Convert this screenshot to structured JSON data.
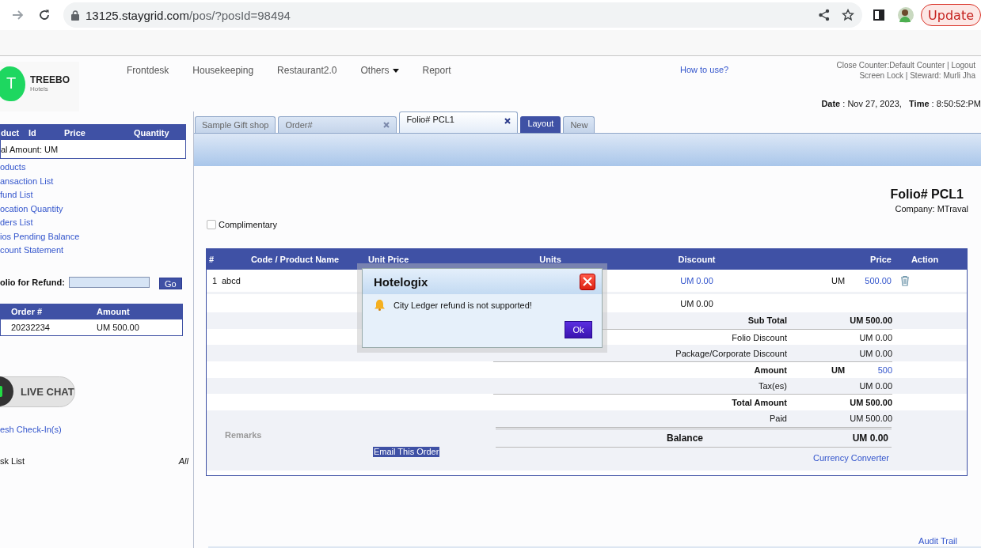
{
  "browser": {
    "url_host": "13125.staygrid.com",
    "url_path": "/pos/?posId=98494",
    "update_label": "Update"
  },
  "logo": {
    "letter": "T",
    "name": "TREEBO",
    "sub": "Hotels"
  },
  "nav": [
    {
      "label": "Frontdesk",
      "kind": "link"
    },
    {
      "label": "Housekeeping",
      "kind": "link"
    },
    {
      "label": "Restaurant2.0",
      "kind": "link"
    },
    {
      "label": "Others",
      "kind": "dropdown"
    },
    {
      "label": "Report",
      "kind": "link"
    }
  ],
  "help_link": "How to use?",
  "user_info": [
    "Close Counter:Default Counter | Logout",
    "Screen Lock | Steward: Murli Jha"
  ],
  "datetime": "**Date** : Nov 27, 2023,   **Time** : 8:50:52:PM",
  "sidebar": {
    "cart": {
      "columns": [
        "duct",
        "Id",
        "Price",
        "Quantity"
      ],
      "total": "al Amount: UM"
    },
    "links": [
      "oducts",
      "ansaction List",
      "fund List",
      "ocation Quantity",
      "ders List",
      "ios Pending Balance",
      "count Statement"
    ],
    "refund": {
      "label": "olio for Refund:",
      "button": "Go"
    },
    "orders": {
      "columns": [
        "Order #",
        "Amount"
      ],
      "rows": [
        [
          "20232234",
          "UM 500.00"
        ]
      ]
    },
    "live_chat": "LIVE CHAT",
    "checkins_link": "esh Check-In(s)",
    "task_list": {
      "label": "sk List",
      "filter": "All"
    }
  },
  "tabs": [
    {
      "label": "Sample Gift shop",
      "kind": "tab",
      "closable": false,
      "selected": false
    },
    {
      "label": "Order#",
      "kind": "tab",
      "closable": true,
      "selected": false
    },
    {
      "label": "Folio# PCL1",
      "kind": "tab",
      "closable": true,
      "selected": true
    },
    {
      "label": "Layout",
      "kind": "action",
      "closable": false,
      "selected": false
    },
    {
      "label": "New",
      "kind": "tab",
      "closable": false,
      "selected": false
    }
  ],
  "folio": {
    "title": "Folio# PCL1",
    "company": "Company: MTraval"
  },
  "complimentary": {
    "label": "Complimentary",
    "checked": false
  },
  "order_table": {
    "columns": [
      "#",
      "Code / Product Name",
      "Unit Price",
      "Units",
      "Discount",
      "Price",
      "Action"
    ],
    "rows": [
      {
        "number": "1",
        "name": "abcd",
        "discount": "UM 0.00",
        "currency": "UM",
        "price": "500.00"
      }
    ],
    "discount_total": "UM 0.00",
    "summary": [
      {
        "label": "Sub Total",
        "value": "UM 500.00",
        "emphasis": true,
        "kind": "plain"
      },
      {
        "label": "Folio Discount",
        "value": "UM 0.00",
        "emphasis": false,
        "kind": "plain"
      },
      {
        "label": "Package/Corporate Discount",
        "value": "UM 0.00",
        "emphasis": false,
        "kind": "plain"
      },
      {
        "label": "Amount",
        "currency": "UM",
        "value": "500",
        "emphasis": true,
        "kind": "link"
      },
      {
        "label": "Tax(es)",
        "value": "UM 0.00",
        "emphasis": false,
        "kind": "plain"
      },
      {
        "label": "Total Amount",
        "value": "UM 500.00",
        "emphasis": true,
        "kind": "plain"
      },
      {
        "label": "Paid",
        "value": "UM 500.00",
        "emphasis": false,
        "kind": "plain"
      }
    ],
    "remarks_label": "Remarks",
    "email_button": "Email This Order",
    "balance": {
      "label": "Balance",
      "value": "UM 0.00"
    },
    "currency_link": "Currency Converter"
  },
  "audit_link": "Audit Trail",
  "dialog": {
    "title": "Hotelogix",
    "message": "City Ledger refund is not supported!",
    "button": "Ok"
  }
}
